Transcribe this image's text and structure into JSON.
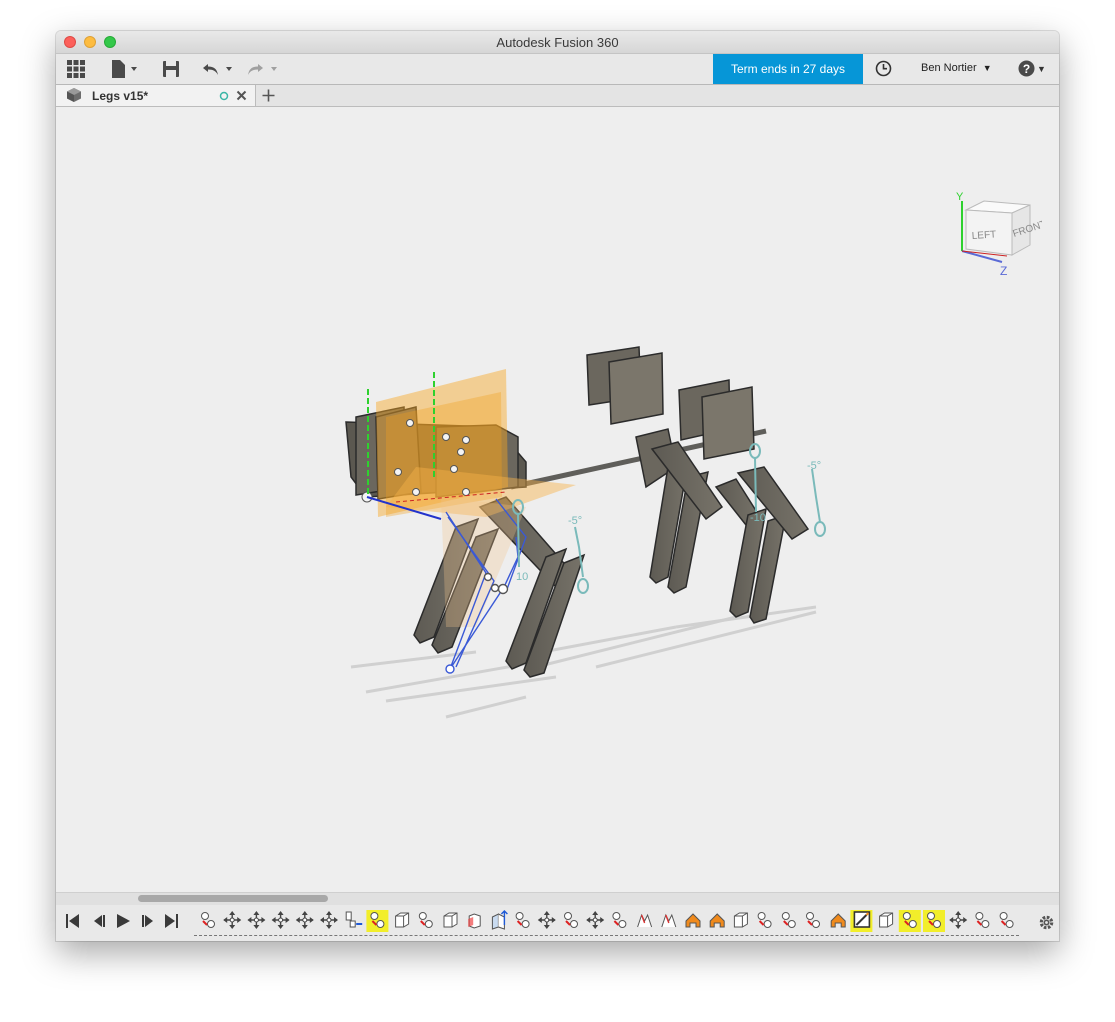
{
  "window": {
    "title": "Autodesk Fusion 360"
  },
  "toolbar": {
    "grid_icon": "data-panel-grid-icon",
    "file_icon": "file-icon",
    "save_icon": "save-icon",
    "undo_icon": "undo-icon",
    "redo_icon": "redo-icon",
    "term_text": "Term ends in 27 days",
    "term_color": "#0696d7",
    "history_icon": "clock-icon",
    "user_name": "Ben Nortier",
    "help_icon": "question-icon"
  },
  "tabs": [
    {
      "label": "Legs v15*",
      "icon": "component-icon",
      "status_icon": "circle-icon",
      "close_icon": "close-icon"
    }
  ],
  "new_tab_icon": "plus-icon",
  "viewcube": {
    "left": "LEFT",
    "front": "FRONT",
    "y_axis": "Y",
    "z_axis": "Z"
  },
  "annotations": {
    "angle_a": "-5°",
    "angle_b": "-5°",
    "val_a": "10",
    "val_b": "-10"
  },
  "timeline": {
    "controls": [
      "skip-back-icon",
      "step-back-icon",
      "play-icon",
      "step-forward-icon",
      "skip-forward-icon"
    ],
    "settings_icon": "gear-icon",
    "features": [
      "joint",
      "move",
      "move",
      "move",
      "move",
      "move",
      "align",
      "joint-hl",
      "box",
      "joint",
      "box",
      "revolve",
      "extrude",
      "joint",
      "move",
      "joint",
      "move",
      "joint",
      "loft",
      "loft",
      "fillet",
      "fillet",
      "box",
      "joint",
      "joint",
      "joint",
      "fillet",
      "sketch-hl",
      "box",
      "joint-hl",
      "joint-hl",
      "move",
      "joint",
      "joint"
    ]
  }
}
